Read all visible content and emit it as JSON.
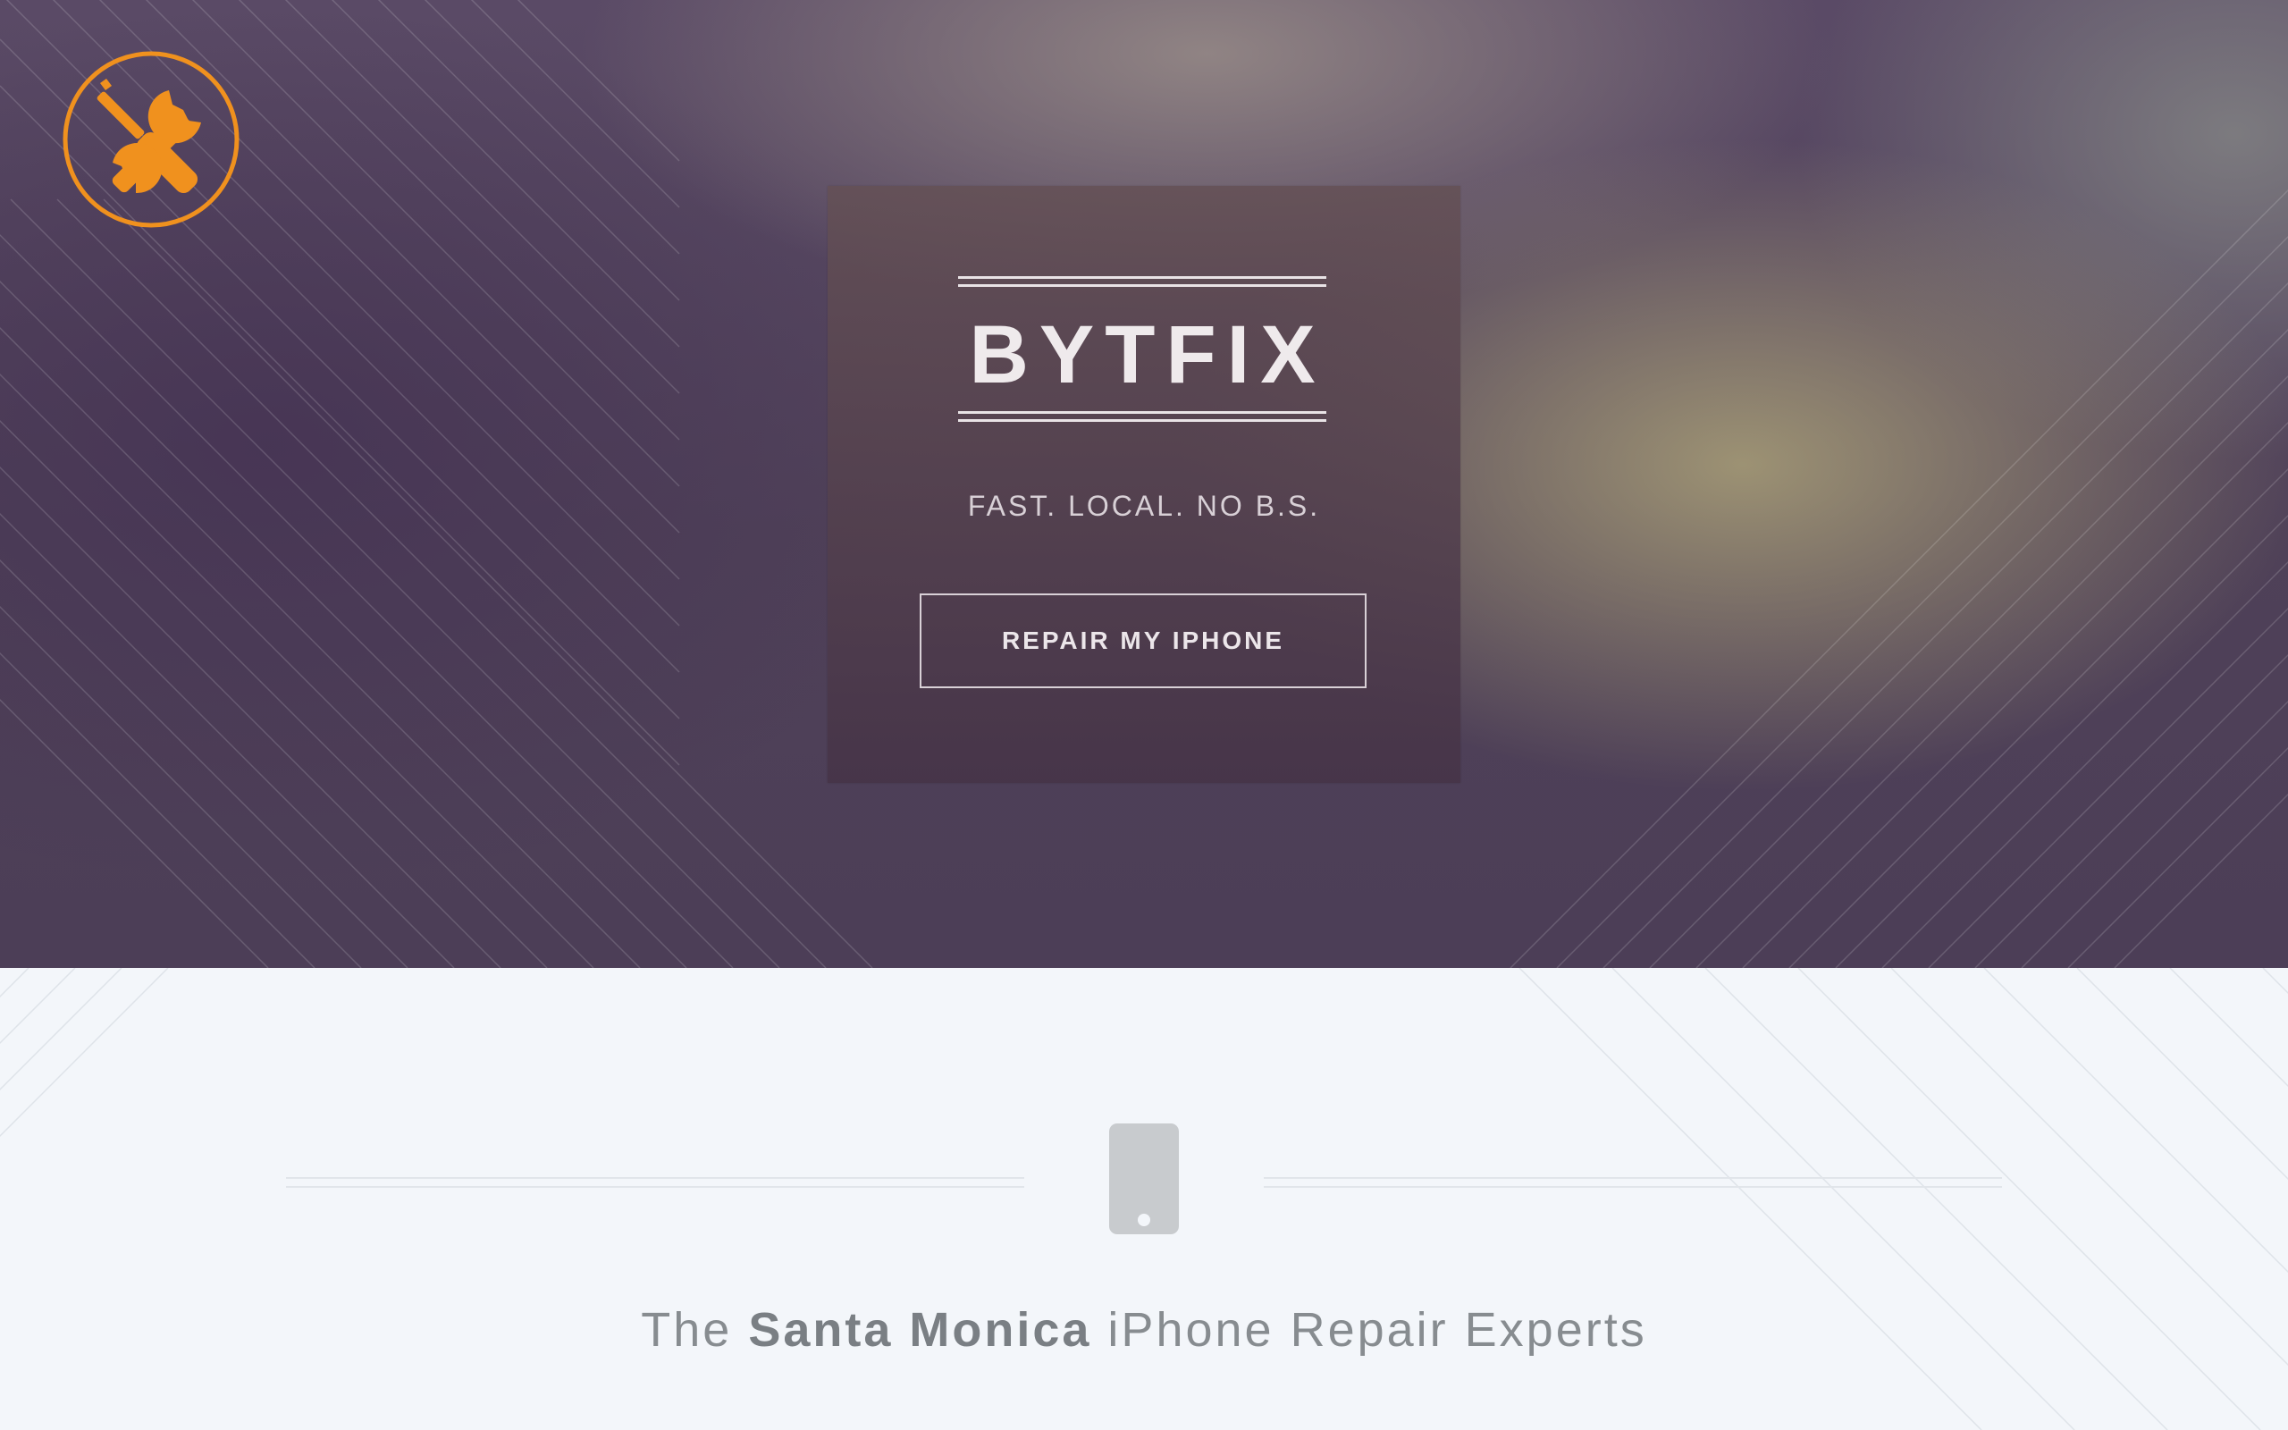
{
  "hero": {
    "logo_icon": "wrench-screwdriver-icon",
    "brand": "BYTFIX",
    "tagline": "FAST. LOCAL. NO B.S.",
    "cta_label": "REPAIR MY IPHONE"
  },
  "section": {
    "icon": "phone-icon",
    "headline_pre": "The ",
    "headline_strong": "Santa Monica",
    "headline_post": " iPhone Repair Experts"
  },
  "colors": {
    "accent_orange": "#f0911e",
    "hero_purple": "#4c3e57",
    "section_bg": "#f3f6fa",
    "icon_gray": "#c8cbce"
  }
}
